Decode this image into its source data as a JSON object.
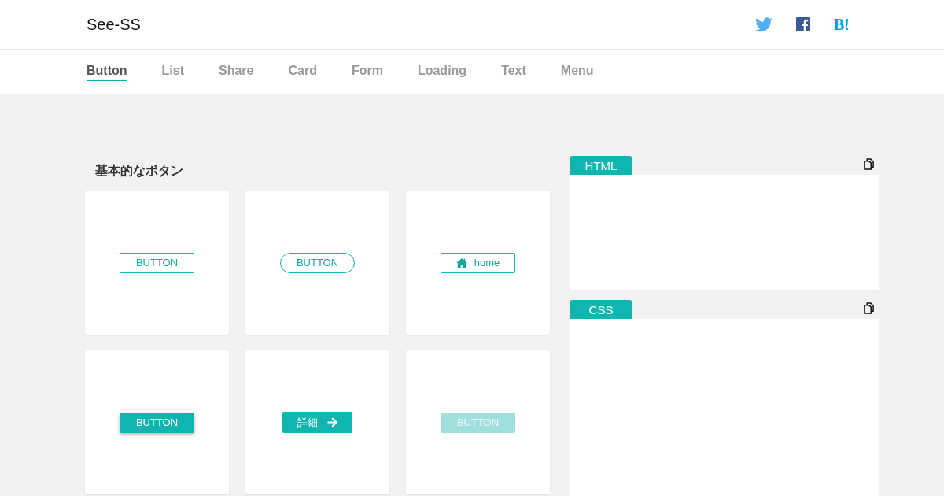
{
  "header": {
    "logo": "See-SS",
    "share_text": "B!"
  },
  "tabs": [
    {
      "label": "Button",
      "selected": true
    },
    {
      "label": "List",
      "selected": false
    },
    {
      "label": "Share",
      "selected": false
    },
    {
      "label": "Card",
      "selected": false
    },
    {
      "label": "Form",
      "selected": false
    },
    {
      "label": "Loading",
      "selected": false
    },
    {
      "label": "Text",
      "selected": false
    },
    {
      "label": "Menu",
      "selected": false
    }
  ],
  "section_title": "基本的なボタン",
  "samples": [
    {
      "kind": "outline",
      "label": "BUTTON",
      "disabled": false
    },
    {
      "kind": "pill",
      "label": "BUTTON",
      "disabled": false
    },
    {
      "kind": "icon-outline",
      "label": "home",
      "disabled": false
    },
    {
      "kind": "raised",
      "label": "BUTTON",
      "disabled": false
    },
    {
      "kind": "arrow",
      "label": "詳細",
      "disabled": false
    },
    {
      "kind": "filled",
      "label": "BUTTON",
      "disabled": true
    }
  ],
  "code_panels": [
    {
      "label": "HTML"
    },
    {
      "label": "CSS"
    }
  ]
}
